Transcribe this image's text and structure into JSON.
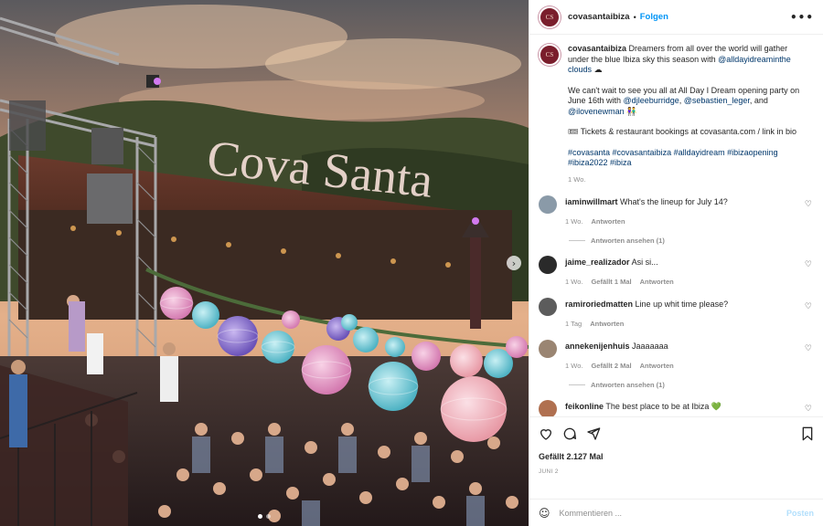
{
  "post": {
    "username": "covasantaibiza",
    "follow_label": "Folgen",
    "avatar_text": "CS",
    "more_icon": "more-horizontal-icon",
    "photo_alt": "Cova Santa outdoor party with lanterns",
    "photo_sign": "Cova Santa"
  },
  "caption": {
    "username": "covasantaibiza",
    "line1_text": "Dreamers from all over the world will gather under the blue Ibiza sky this season with ",
    "mention1": "@alldayidreaminthe clouds",
    "cloud_emoji": "☁",
    "para2_text": "We can't wait to see you all at All Day I Dream opening party on June 16th with ",
    "mention2": "@djleeburridge",
    "sep1": ", ",
    "mention3": "@sebastien_leger",
    "sep2": ", and ",
    "mention4": "@ilovenewman",
    "people_emoji": "👫",
    "para3": "🎟 Tickets & restaurant bookings at covasanta.com / link in bio",
    "hashtags": "#covasanta #covasantaibiza #alldayidream #ibizaopening #ibiza2022 #ibiza",
    "time": "1 Wo."
  },
  "comments": [
    {
      "user": "iaminwillmart",
      "text": "What's the lineup for July 14?",
      "time": "1 Wo.",
      "likes": "",
      "reply": "Antworten",
      "view_replies": "Antworten ansehen (1)",
      "avatar_color": "#8a9aa8"
    },
    {
      "user": "jaime_realizador",
      "text": "Asi si...",
      "time": "1 Wo.",
      "likes": "Gefällt 1 Mal",
      "reply": "Antworten",
      "view_replies": "",
      "avatar_color": "#2a2a2a"
    },
    {
      "user": "ramiroriedmatten",
      "text": "Line up whit time please?",
      "time": "1 Tag",
      "likes": "",
      "reply": "Antworten",
      "view_replies": "",
      "avatar_color": "#5c5c5c"
    },
    {
      "user": "annekenijenhuis",
      "text": "Jaaaaaaa",
      "time": "1 Wo.",
      "likes": "Gefällt 2 Mal",
      "reply": "Antworten",
      "view_replies": "Antworten ansehen (1)",
      "avatar_color": "#9a8572"
    },
    {
      "user": "feikonline",
      "text": "The best place to be at Ibiza 💚",
      "time": "",
      "likes": "",
      "reply": "",
      "view_replies": "",
      "avatar_color": "#b07050"
    }
  ],
  "actions": {
    "like_icon": "heart-icon",
    "comment_icon": "comment-icon",
    "share_icon": "send-icon",
    "save_icon": "bookmark-icon",
    "likes_text": "Gefällt 2.127 Mal",
    "date": "JUNI 2"
  },
  "compose": {
    "emoji_icon": "emoji-icon",
    "placeholder": "Kommentieren ...",
    "post_label": "Posten"
  },
  "colors": {
    "accent": "#0095f6",
    "brand": "#7a1e2c"
  }
}
